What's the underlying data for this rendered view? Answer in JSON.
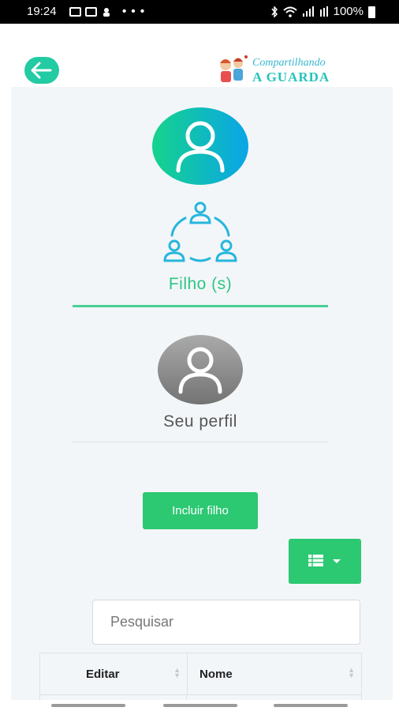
{
  "status_bar": {
    "time": "19:24",
    "battery": "100%"
  },
  "header": {
    "logo_line1": "Compartilhando",
    "logo_line2": "A GUARDA"
  },
  "sections": {
    "children_label": "Filho (s)",
    "profile_label": "Seu perfil"
  },
  "actions": {
    "add_child_label": "Incluir filho"
  },
  "search": {
    "placeholder": "Pesquisar"
  },
  "table": {
    "columns": [
      "Editar",
      "Nome"
    ]
  },
  "colors": {
    "accent_green": "#2cc872",
    "teal": "#22cba3",
    "content_bg": "#f3f6f8"
  }
}
